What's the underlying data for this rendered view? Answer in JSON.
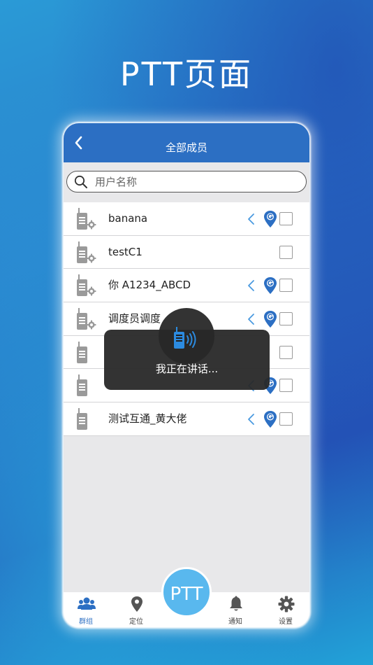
{
  "hero": {
    "title": "PTT页面"
  },
  "header": {
    "title": "全部成员",
    "back_icon": "chevron-left-icon"
  },
  "search": {
    "placeholder": "用户名称",
    "value": "",
    "icon": "search-icon"
  },
  "members": [
    {
      "name": "banana",
      "icon": "radio-gear-icon",
      "show_actions": true
    },
    {
      "name": "testC1",
      "icon": "radio-gear-icon",
      "show_actions": false
    },
    {
      "name": "你 A1234_ABCD",
      "icon": "radio-gear-icon",
      "show_actions": true
    },
    {
      "name": "调度员调度",
      "icon": "radio-gear-icon",
      "show_actions": true
    },
    {
      "name": "",
      "icon": "radio-icon",
      "show_actions": false
    },
    {
      "name": "",
      "icon": "radio-icon",
      "show_actions": true
    },
    {
      "name": "测试互通_黄大佬",
      "icon": "radio-icon",
      "show_actions": true
    }
  ],
  "toast": {
    "text": "我正在讲话...",
    "icon": "walkie-talkie-speaking-icon"
  },
  "ptt_button": {
    "label": "PTT"
  },
  "tabs": [
    {
      "label": "群组",
      "icon": "group-icon",
      "active": true
    },
    {
      "label": "定位",
      "icon": "location-pin-icon",
      "active": false
    },
    {
      "label": "通知",
      "icon": "bell-icon",
      "active": false
    },
    {
      "label": "设置",
      "icon": "gear-icon",
      "active": false
    }
  ],
  "colors": {
    "accent": "#2c6fc3",
    "ptt": "#59b8ee",
    "map_pin": "#2c6fc3",
    "icon_gray": "#9a9a9a"
  }
}
